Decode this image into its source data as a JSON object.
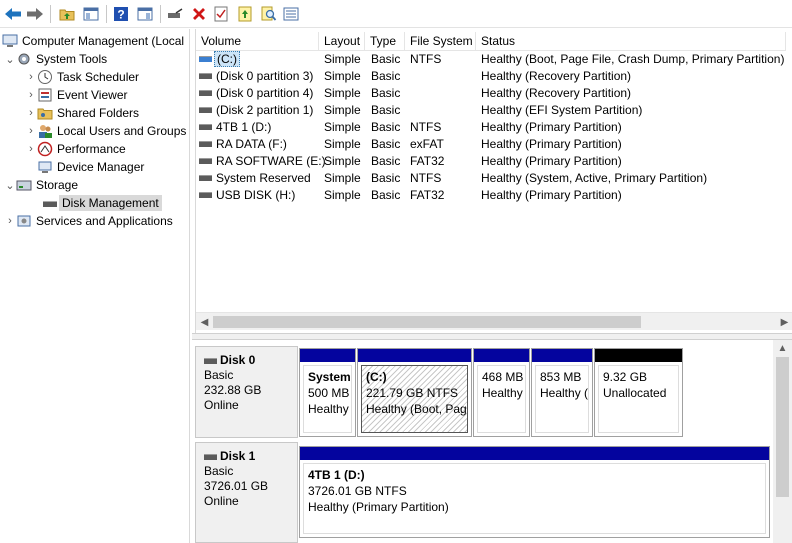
{
  "tree": {
    "root": "Computer Management (Local",
    "system_tools": "System Tools",
    "task_scheduler": "Task Scheduler",
    "event_viewer": "Event Viewer",
    "shared_folders": "Shared Folders",
    "local_users": "Local Users and Groups",
    "performance": "Performance",
    "device_manager": "Device Manager",
    "storage": "Storage",
    "disk_management": "Disk Management",
    "services": "Services and Applications"
  },
  "list": {
    "columns": [
      "Volume",
      "Layout",
      "Type",
      "File System",
      "Status"
    ],
    "rows": [
      {
        "volume": "(C:)",
        "layout": "Simple",
        "type": "Basic",
        "fs": "NTFS",
        "status": "Healthy (Boot, Page File, Crash Dump, Primary Partition)"
      },
      {
        "volume": "(Disk 0 partition 3)",
        "layout": "Simple",
        "type": "Basic",
        "fs": "",
        "status": "Healthy (Recovery Partition)"
      },
      {
        "volume": "(Disk 0 partition 4)",
        "layout": "Simple",
        "type": "Basic",
        "fs": "",
        "status": "Healthy (Recovery Partition)"
      },
      {
        "volume": "(Disk 2 partition 1)",
        "layout": "Simple",
        "type": "Basic",
        "fs": "",
        "status": "Healthy (EFI System Partition)"
      },
      {
        "volume": "4TB 1 (D:)",
        "layout": "Simple",
        "type": "Basic",
        "fs": "NTFS",
        "status": "Healthy (Primary Partition)"
      },
      {
        "volume": "RA DATA (F:)",
        "layout": "Simple",
        "type": "Basic",
        "fs": "exFAT",
        "status": "Healthy (Primary Partition)"
      },
      {
        "volume": "RA SOFTWARE (E:)",
        "layout": "Simple",
        "type": "Basic",
        "fs": "FAT32",
        "status": "Healthy (Primary Partition)"
      },
      {
        "volume": "System Reserved",
        "layout": "Simple",
        "type": "Basic",
        "fs": "NTFS",
        "status": "Healthy (System, Active, Primary Partition)"
      },
      {
        "volume": "USB DISK (H:)",
        "layout": "Simple",
        "type": "Basic",
        "fs": "FAT32",
        "status": "Healthy (Primary Partition)"
      }
    ]
  },
  "disks": [
    {
      "name": "Disk 0",
      "kind": "Basic",
      "size": "232.88 GB",
      "state": "Online",
      "partitions": [
        {
          "title": "System",
          "size": "500 MB",
          "status": "Healthy"
        },
        {
          "title": "(C:)",
          "size": "221.79 GB NTFS",
          "status": "Healthy (Boot, Pag"
        },
        {
          "title": "",
          "size": "468 MB",
          "status": "Healthy"
        },
        {
          "title": "",
          "size": "853 MB",
          "status": "Healthy ("
        },
        {
          "title": "",
          "size": "9.32 GB",
          "status": "Unallocated"
        }
      ]
    },
    {
      "name": "Disk 1",
      "kind": "Basic",
      "size": "3726.01 GB",
      "state": "Online",
      "partitions": [
        {
          "title": "4TB 1  (D:)",
          "size": "3726.01 GB NTFS",
          "status": "Healthy (Primary Partition)"
        }
      ]
    }
  ],
  "colors": {
    "partition_bar": "#04049e",
    "unallocated_bar": "#000000",
    "selection": "#cce4f7"
  }
}
